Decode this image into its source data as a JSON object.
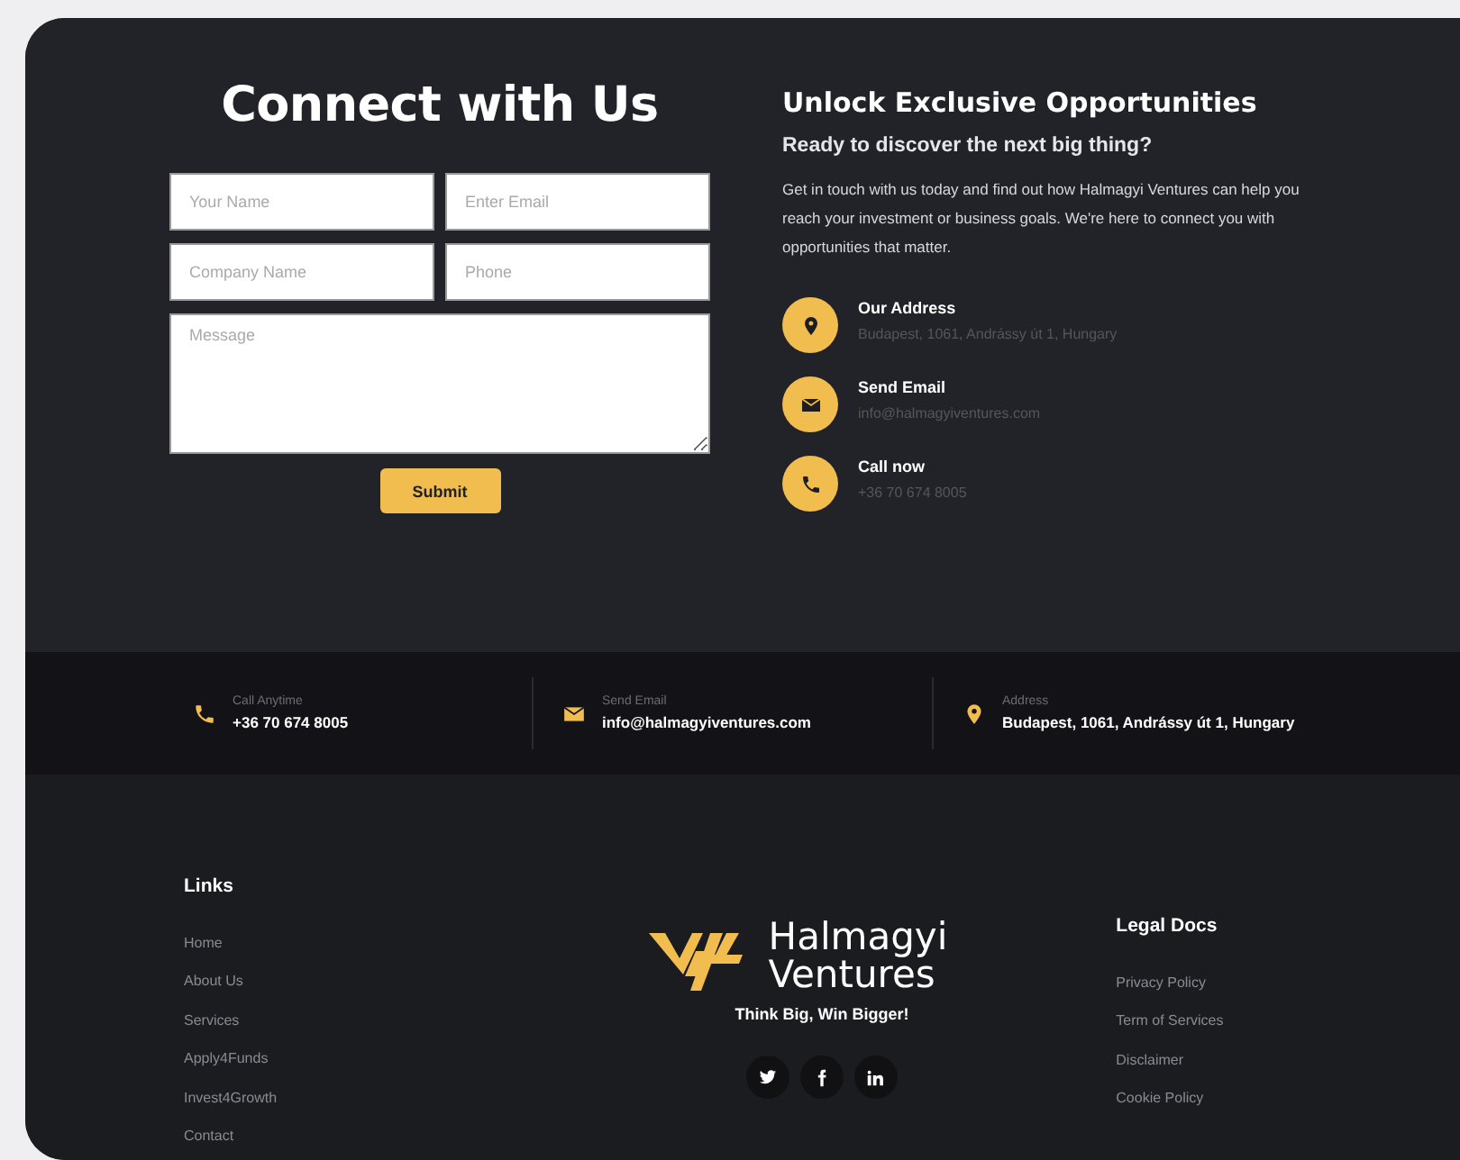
{
  "contact_form": {
    "title": "Connect with Us",
    "fields": [
      {
        "kind": "input",
        "placeholder": "Your Name"
      },
      {
        "kind": "input",
        "placeholder": "Enter Email"
      },
      {
        "kind": "input",
        "placeholder": "Company Name"
      },
      {
        "kind": "input",
        "placeholder": "Phone"
      },
      {
        "kind": "textarea",
        "placeholder": "Message"
      }
    ],
    "submit": "Submit"
  },
  "info": {
    "title": "Unlock Exclusive Opportunities",
    "subtitle": "Ready to discover the next big thing?",
    "text": "Get in touch with us today and find out how Halmagyi Ventures can help you reach your investment or business goals. We're here to connect you with opportunities that matter.",
    "contacts": [
      {
        "kind": "address",
        "label": "Our Address",
        "value": "Budapest, 1061, Andrássy út 1, Hungary"
      },
      {
        "kind": "email",
        "label": "Send Email",
        "value": "info@halmagyiventures.com"
      },
      {
        "kind": "phone",
        "label": "Call now",
        "value": "+36 70 674 8005"
      }
    ]
  },
  "contact_strip": [
    {
      "kind": "phone",
      "label": "Call Anytime",
      "value": "+36 70 674 8005"
    },
    {
      "kind": "email",
      "label": "Send Email",
      "value": "info@halmagyiventures.com"
    },
    {
      "kind": "address",
      "label": "Address",
      "value": "Budapest, 1061, Andrássy út 1, Hungary"
    }
  ],
  "footer": {
    "links": {
      "title": "Links",
      "items": [
        "Home",
        "About Us",
        "Services",
        "Apply4Funds",
        "Invest4Growth",
        "Contact"
      ]
    },
    "brand": {
      "name": [
        "Halmagyi",
        "Ventures"
      ],
      "tagline": "Think Big, Win Bigger!"
    },
    "social": [
      {
        "kind": "twitter"
      },
      {
        "kind": "facebook"
      },
      {
        "kind": "linkedin"
      }
    ],
    "legal": {
      "title": "Legal Docs",
      "items": [
        "Privacy Policy",
        "Term of Services",
        "Disclaimer",
        "Cookie Policy"
      ]
    }
  }
}
